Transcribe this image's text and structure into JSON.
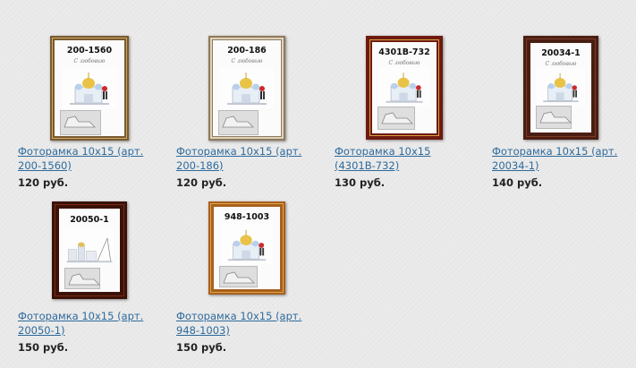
{
  "products": [
    {
      "code": "200-1560",
      "title_line1": "Фоторамка 10x15 (арт.",
      "title_line2": "200-1560)",
      "price": "120 руб.",
      "frame_color": "#7a5a2e",
      "frame_accent": "#c9a869",
      "photo": "church"
    },
    {
      "code": "200-186",
      "title_line1": "Фоторамка 10x15 (арт.",
      "title_line2": "200-186)",
      "price": "120 руб.",
      "frame_color": "#8f7a5c",
      "frame_accent": "#ddd2bb",
      "photo": "church"
    },
    {
      "code": "4301B-732",
      "title_line1": "Фоторамка 10x15",
      "title_line2": "(4301B-732)",
      "price": "130 руб.",
      "frame_color": "#6e1a10",
      "frame_accent": "#d8a53a",
      "photo": "church"
    },
    {
      "code": "20034-1",
      "title_line1": "Фоторамка 10x15 (арт.",
      "title_line2": "20034-1)",
      "price": "140 руб.",
      "frame_color": "#4a1e12",
      "frame_accent": "#7c3b24",
      "photo": "church"
    },
    {
      "code": "20050-1",
      "title_line1": "Фоторамка 10x15 (арт.",
      "title_line2": "20050-1)",
      "price": "150 руб.",
      "frame_color": "#3a1208",
      "frame_accent": "#7a2a14",
      "photo": "city"
    },
    {
      "code": "948-1003",
      "title_line1": "Фоторамка 10x15 (арт.",
      "title_line2": "948-1003)",
      "price": "150 руб.",
      "frame_color": "#a8601c",
      "frame_accent": "#e4a44a",
      "photo": "church"
    }
  ]
}
